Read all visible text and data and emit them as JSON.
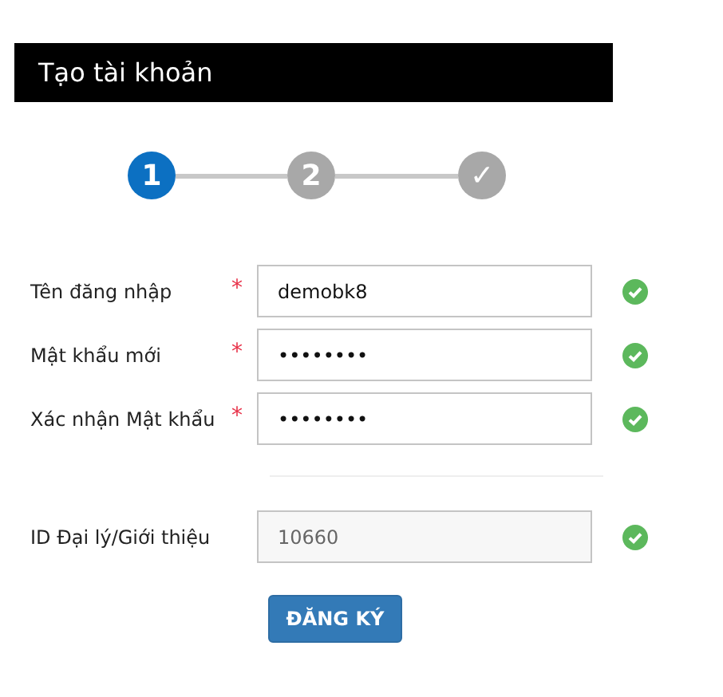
{
  "header": {
    "title": "Tạo tài khoản"
  },
  "steps": [
    {
      "label": "1",
      "selected": true
    },
    {
      "label": "2",
      "selected": false
    },
    {
      "label": "✓",
      "selected": false
    }
  ],
  "fields": [
    {
      "label": "Tên đăng nhập",
      "required_mark": "*",
      "value": "demobk8",
      "valid": true,
      "disabled": false
    },
    {
      "label": "Mật khẩu mới",
      "required_mark": "*",
      "value": "••••••••",
      "valid": true,
      "disabled": false
    },
    {
      "label": "Xác nhận Mật khẩu",
      "required_mark": "*",
      "value": "••••••••",
      "valid": true,
      "disabled": false
    }
  ],
  "referral": {
    "label": "ID Đại lý/Giới thiệu",
    "value": "10660",
    "valid": true,
    "disabled": true
  },
  "submit": {
    "label": "ĐĂNG KÝ"
  }
}
